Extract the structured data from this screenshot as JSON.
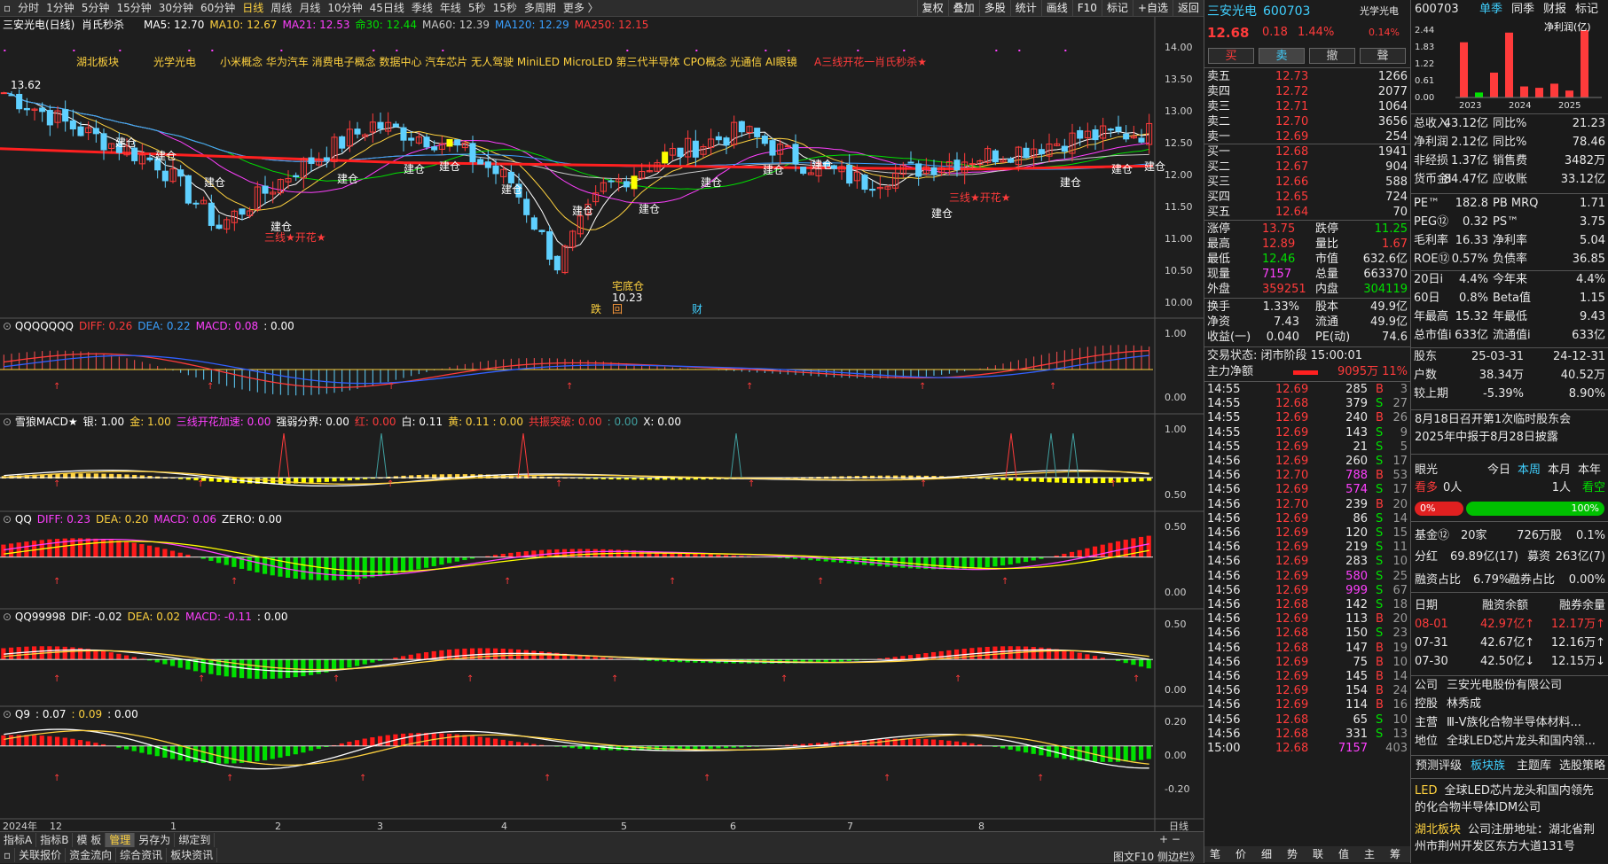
{
  "toolbar": {
    "periods": [
      "分时",
      "1分钟",
      "5分钟",
      "15分钟",
      "30分钟",
      "60分钟",
      "日线",
      "周线",
      "月线",
      "10分钟",
      "45日线",
      "季线",
      "年线",
      "5秒",
      "15秒",
      "多周期",
      "更多 〉"
    ],
    "active": "日线",
    "right_buttons": [
      "复权",
      "叠加",
      "多股",
      "统计",
      "画线",
      "F10",
      "标记",
      "+自选",
      "返回"
    ]
  },
  "main_chart": {
    "title": "三安光电(日线)",
    "indicator": "肖氏秒杀",
    "ma": [
      {
        "label": "MA5: 12.70",
        "color": "#ffffff"
      },
      {
        "label": "MA10: 12.67",
        "color": "#ffd23f"
      },
      {
        "label": "MA21: 12.53",
        "color": "#ff40ff"
      },
      {
        "label": "命30: 12.44",
        "color": "#00e000"
      },
      {
        "label": "MA60: 12.39",
        "color": "#c8c8c8"
      },
      {
        "label": "MA120: 12.29",
        "color": "#3aa0ff"
      },
      {
        "label": "MA250: 12.15",
        "color": "#ff3b3b"
      }
    ],
    "concepts": [
      "湖北板块",
      "光学光电",
      "小米概念 华为汽车 消费电子概念 数据中心 汽车芯片 无人驾驶 MiniLED MicroLED 第三代半导体 CPO概念 光通信 AI眼镜",
      "A三线开花一肖氏秒杀★"
    ],
    "hi_label": "13.62",
    "lo_label": "10.23",
    "lo_note": "宅底仓",
    "y_axis": [
      "14.00",
      "13.50",
      "13.00",
      "12.50",
      "12.00",
      "11.50",
      "11.00",
      "10.50",
      "10.00"
    ],
    "markers": [
      "跌",
      "回",
      "财"
    ],
    "build_label": "建仓",
    "flower_label": "三线★开花★"
  },
  "panels": [
    {
      "name": "QQQQQQQ",
      "items": [
        {
          "t": "DIFF: 0.26",
          "c": "#ff3b3b"
        },
        {
          "t": "DEA: 0.22",
          "c": "#3aa0ff"
        },
        {
          "t": "MACD: 0.08",
          "c": "#ff40ff"
        },
        {
          "t": ": 0.00",
          "c": "#ffffff"
        }
      ],
      "axis": [
        "1.00",
        "0.00"
      ]
    },
    {
      "name": "雪狼MACD★",
      "items": [
        {
          "t": "银: 1.00",
          "c": "#ffffff"
        },
        {
          "t": "金: 1.00",
          "c": "#ffd23f"
        },
        {
          "t": "三线开花加速: 0.00",
          "c": "#ff40ff"
        },
        {
          "t": "强弱分界: 0.00",
          "c": "#ffffff"
        },
        {
          "t": "红: 0.00",
          "c": "#ff3b3b"
        },
        {
          "t": "白: 0.11",
          "c": "#ffffff"
        },
        {
          "t": "黄: 0.11 : 0.00",
          "c": "#ffd23f"
        },
        {
          "t": "共振突破: 0.00",
          "c": "#ff3b3b"
        },
        {
          "t": ": 0.00",
          "c": "#40a0a0"
        },
        {
          "t": "X: 0.00",
          "c": "#ffffff"
        }
      ],
      "axis": [
        "1.00",
        "0.50"
      ]
    },
    {
      "name": "QQ",
      "items": [
        {
          "t": "DIFF: 0.23",
          "c": "#ff40ff"
        },
        {
          "t": "DEA: 0.20",
          "c": "#ffd23f"
        },
        {
          "t": "MACD: 0.06",
          "c": "#ff40ff"
        },
        {
          "t": "ZERO: 0.00",
          "c": "#ffffff"
        }
      ],
      "axis": [
        "0.50",
        "0.00"
      ]
    },
    {
      "name": "QQ99998",
      "items": [
        {
          "t": "DIF: -0.02",
          "c": "#ffffff"
        },
        {
          "t": "DEA: 0.02",
          "c": "#ffd23f"
        },
        {
          "t": "MACD: -0.11",
          "c": "#ff40ff"
        },
        {
          "t": ": 0.00",
          "c": "#ffffff"
        }
      ],
      "axis": [
        "0.50",
        "0.00"
      ]
    },
    {
      "name": "Q9",
      "items": [
        {
          "t": ": 0.07",
          "c": "#ffffff"
        },
        {
          "t": ": 0.09",
          "c": "#ffd23f"
        },
        {
          "t": ": 0.00",
          "c": "#ffffff"
        }
      ],
      "axis": [
        "0.20",
        "0.00",
        "-0.20"
      ]
    }
  ],
  "x_axis": [
    "2024年",
    "12",
    "1",
    "2",
    "3",
    "4",
    "5",
    "6",
    "7",
    "8"
  ],
  "x_axis_right": "日线",
  "bottom_tabs1": [
    "指标A",
    "指标B",
    "模 板",
    "管理",
    "另存为",
    "绑定到"
  ],
  "bottom_tabs2": [
    "关联报价",
    "资金流向",
    "综合资讯",
    "板块资讯"
  ],
  "bottom_right": "图文F10 侧边栏》",
  "quote": {
    "name": "三安光电",
    "code": "600703",
    "price": "12.68",
    "chg": "0.18",
    "pct": "1.44%",
    "tag": "光学光电",
    "tag_pct": "0.14%",
    "btns": [
      "买",
      "卖",
      "撤",
      "聲"
    ],
    "asks": [
      [
        "卖五",
        "12.73",
        "1266"
      ],
      [
        "卖四",
        "12.72",
        "2077"
      ],
      [
        "卖三",
        "12.71",
        "1064"
      ],
      [
        "卖二",
        "12.70",
        "3656"
      ],
      [
        "卖一",
        "12.69",
        "254"
      ]
    ],
    "bids": [
      [
        "买一",
        "12.68",
        "1941"
      ],
      [
        "买二",
        "12.67",
        "904"
      ],
      [
        "买三",
        "12.66",
        "588"
      ],
      [
        "买四",
        "12.65",
        "724"
      ],
      [
        "买五",
        "12.64",
        "70"
      ]
    ],
    "stats": [
      [
        "涨停",
        "13.75",
        "red",
        "跌停",
        "11.25",
        "grn"
      ],
      [
        "最高",
        "12.89",
        "red",
        "量比",
        "1.67",
        "red"
      ],
      [
        "最低",
        "12.46",
        "grn",
        "市值",
        "632.6亿",
        "wht"
      ],
      [
        "现量",
        "7157",
        "mag",
        "总量",
        "663370",
        "wht"
      ],
      [
        "外盘",
        "359251",
        "red",
        "内盘",
        "304119",
        "grn"
      ]
    ],
    "stats2": [
      [
        "换手",
        "1.33%",
        "股本",
        "49.9亿"
      ],
      [
        "净资",
        "7.43",
        "流通",
        "49.9亿"
      ],
      [
        "收益(一)",
        "0.040",
        "PE(动)",
        "74.6"
      ]
    ],
    "trade_status": "交易状态: 闭市阶段 15:00:01",
    "main_flow_label": "主力净额",
    "main_flow": "9095万",
    "main_flow_pct": "11%",
    "ticks": [
      [
        "14:55",
        "12.69",
        "285",
        "B",
        "3"
      ],
      [
        "14:55",
        "12.68",
        "379",
        "S",
        "27"
      ],
      [
        "14:55",
        "12.69",
        "240",
        "B",
        "26"
      ],
      [
        "14:55",
        "12.69",
        "143",
        "S",
        "9"
      ],
      [
        "14:55",
        "12.69",
        "21",
        "S",
        "5"
      ],
      [
        "14:56",
        "12.69",
        "260",
        "S",
        "17"
      ],
      [
        "14:56",
        "12.70",
        "788",
        "B",
        "53"
      ],
      [
        "14:56",
        "12.69",
        "574",
        "S",
        "17"
      ],
      [
        "14:56",
        "12.70",
        "239",
        "B",
        "20"
      ],
      [
        "14:56",
        "12.69",
        "86",
        "S",
        "14"
      ],
      [
        "14:56",
        "12.69",
        "120",
        "S",
        "15"
      ],
      [
        "14:56",
        "12.69",
        "219",
        "S",
        "11"
      ],
      [
        "14:56",
        "12.69",
        "283",
        "S",
        "10"
      ],
      [
        "14:56",
        "12.69",
        "580",
        "S",
        "25"
      ],
      [
        "14:56",
        "12.69",
        "999",
        "S",
        "67"
      ],
      [
        "14:56",
        "12.68",
        "142",
        "S",
        "18"
      ],
      [
        "14:56",
        "12.69",
        "113",
        "B",
        "20"
      ],
      [
        "14:56",
        "12.68",
        "150",
        "S",
        "23"
      ],
      [
        "14:56",
        "12.68",
        "147",
        "B",
        "19"
      ],
      [
        "14:56",
        "12.69",
        "75",
        "B",
        "10"
      ],
      [
        "14:56",
        "12.69",
        "145",
        "B",
        "14"
      ],
      [
        "14:56",
        "12.69",
        "154",
        "B",
        "24"
      ],
      [
        "14:56",
        "12.69",
        "114",
        "B",
        "16"
      ],
      [
        "14:56",
        "12.68",
        "65",
        "S",
        "10"
      ],
      [
        "14:56",
        "12.68",
        "331",
        "S",
        "13"
      ],
      [
        "15:00",
        "12.68",
        "7157",
        "",
        "403"
      ]
    ],
    "side_tabs": [
      "笔",
      "价",
      "细",
      "势",
      "联",
      "值",
      "主",
      "筹"
    ]
  },
  "f10": {
    "code": "600703",
    "tabs": [
      "单季",
      "同季",
      "财报",
      "标记"
    ],
    "bar_y": [
      "2.44",
      "1.83",
      "1.22",
      "0.61",
      "0.00"
    ],
    "bar_years": [
      "2023",
      "2024",
      "2025"
    ],
    "bar_legend": "净利润(亿)",
    "bars": [
      {
        "v": 2.0,
        "c": "#ff3b3b"
      },
      {
        "v": 0.18,
        "c": "#00e000"
      },
      {
        "v": 0.9,
        "c": "#ff3b3b"
      },
      {
        "v": 2.35,
        "c": "#ff3b3b"
      },
      {
        "v": 0.4,
        "c": "#ff3b3b"
      },
      {
        "v": 0.35,
        "c": "#ff3b3b"
      },
      {
        "v": 0.5,
        "c": "#ff3b3b"
      },
      {
        "v": 0.25,
        "c": "#ff3b3b"
      },
      {
        "v": 2.44,
        "c": "#ff3b3b"
      }
    ],
    "fin": [
      [
        "总收入",
        "43.12亿",
        "同比%",
        "21.23"
      ],
      [
        "净利润",
        "2.12亿",
        "同比%",
        "78.46"
      ],
      [
        "非经损",
        "1.37亿",
        "销售费",
        "3482万"
      ],
      [
        "货币金i",
        "84.47亿",
        "应收账",
        "33.12亿"
      ]
    ],
    "val": [
      [
        "PE™",
        "182.8",
        "PB MRQ",
        "1.71"
      ],
      [
        "PEG⑫",
        "0.32",
        "PS™",
        "3.75"
      ],
      [
        "毛利率",
        "16.33",
        "净利率",
        "5.04"
      ],
      [
        "ROE⑫",
        "0.57%",
        "负债率",
        "36.85"
      ]
    ],
    "perf": [
      [
        "20日i",
        "4.4%",
        "今年来",
        "4.4%"
      ],
      [
        "60日",
        "0.8%",
        "Beta值",
        "1.15"
      ],
      [
        "年最高",
        "15.32",
        "年最低",
        "9.43"
      ],
      [
        "总市值i",
        "633亿",
        "流通值i",
        "633亿"
      ]
    ],
    "holders": [
      [
        "股东",
        "25-03-31",
        "24-12-31"
      ],
      [
        "户数",
        "38.34万",
        "40.52万"
      ],
      [
        "较上期",
        "-5.39%",
        "8.90%"
      ]
    ],
    "news": [
      "8月18日召开第1次临时股东会",
      "2025年中报于8月28日披露"
    ],
    "eye": {
      "label": "眼光",
      "tabs": [
        "今日",
        "本周",
        "本月",
        "本年"
      ],
      "bull": "看多",
      "bull_n": "0人",
      "bear_n": "1人",
      "bear": "看空",
      "bull_pct": "0%",
      "bear_pct": "100%",
      "bull_frac": 0.0,
      "bear_frac": 1.0
    },
    "fund": [
      "基金⑫",
      "20家",
      "726万股",
      "0.1%"
    ],
    "score": [
      "分红",
      "69.89亿(17)",
      "募资",
      "263亿(7)"
    ],
    "margin_ratio": [
      "融资占比",
      "6.79%",
      "融券占比",
      "0.00%"
    ],
    "margin_head": [
      "日期",
      "融资余额",
      "融券余量"
    ],
    "margin": [
      [
        "08-01",
        "42.97亿↑",
        "12.17万↑"
      ],
      [
        "07-31",
        "42.67亿↑",
        "12.16万↑"
      ],
      [
        "07-30",
        "42.50亿↓",
        "12.15万↓"
      ]
    ],
    "company": [
      [
        "公司",
        "三安光电股份有限公司"
      ],
      [
        "控股",
        "林秀成"
      ],
      [
        "主营",
        "Ⅲ-Ⅴ族化合物半导体材料..."
      ],
      [
        "地位",
        "全球LED芯片龙头和国内领..."
      ]
    ],
    "ftabs": [
      "预测评级",
      "板块族",
      "主题库",
      "选股策略"
    ],
    "led_tag": "LED",
    "led_text": "全球LED芯片龙头和国内领先的化合物半导体IDM公司",
    "hb_tag": "湖北板块",
    "hb_text": "公司注册地址：湖北省荆州市荆州开发区东方大道131号"
  }
}
